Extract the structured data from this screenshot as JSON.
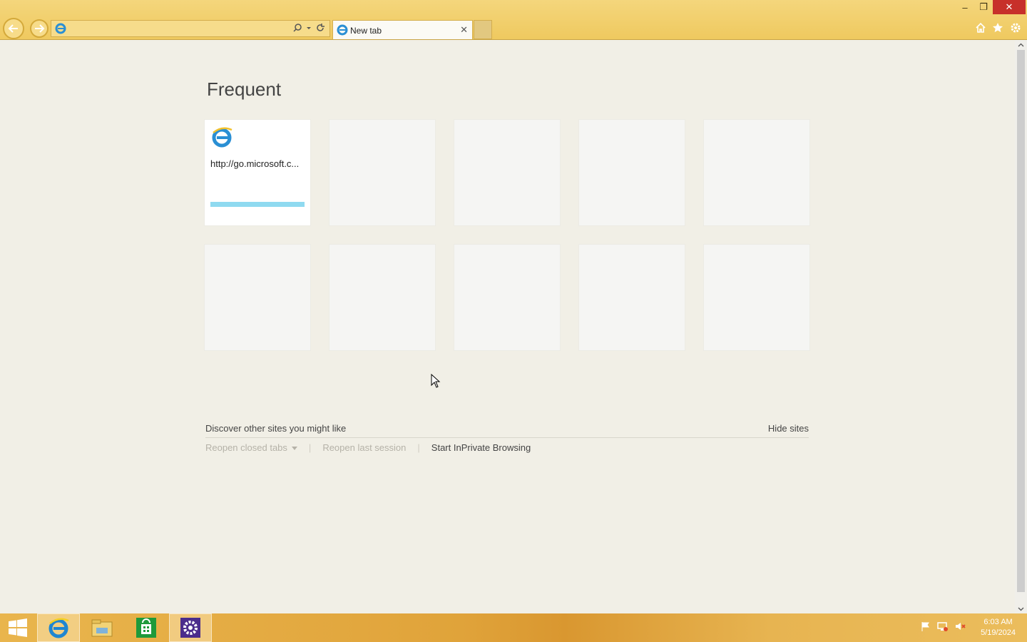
{
  "browser": {
    "address_value": "",
    "tab_title": "New tab",
    "tab_close_glyph": "✕",
    "window_controls": {
      "minimize": "–",
      "restore": "❐",
      "close": "✕"
    }
  },
  "page": {
    "heading": "Frequent",
    "tiles": [
      {
        "url": "http://go.microsoft.c...",
        "icon": "ie-icon",
        "load_fraction": 1.0
      },
      {
        "url": ""
      },
      {
        "url": ""
      },
      {
        "url": ""
      },
      {
        "url": ""
      },
      {
        "url": ""
      },
      {
        "url": ""
      },
      {
        "url": ""
      },
      {
        "url": ""
      },
      {
        "url": ""
      }
    ],
    "discover_label": "Discover other sites you might like",
    "hide_sites": "Hide sites",
    "reopen_closed_tabs": "Reopen closed tabs",
    "reopen_last_session": "Reopen last session",
    "start_inprivate": "Start InPrivate Browsing"
  },
  "taskbar": {
    "apps": [
      "start-icon",
      "internet-explorer-icon",
      "file-explorer-icon",
      "store-icon",
      "settings-icon"
    ],
    "clock_time": "6:03 AM",
    "clock_date": "5/19/2024"
  },
  "colors": {
    "toolbar": "#efc95f",
    "page_background": "#f1efe6",
    "tile_progress": "#8fdaf0"
  }
}
